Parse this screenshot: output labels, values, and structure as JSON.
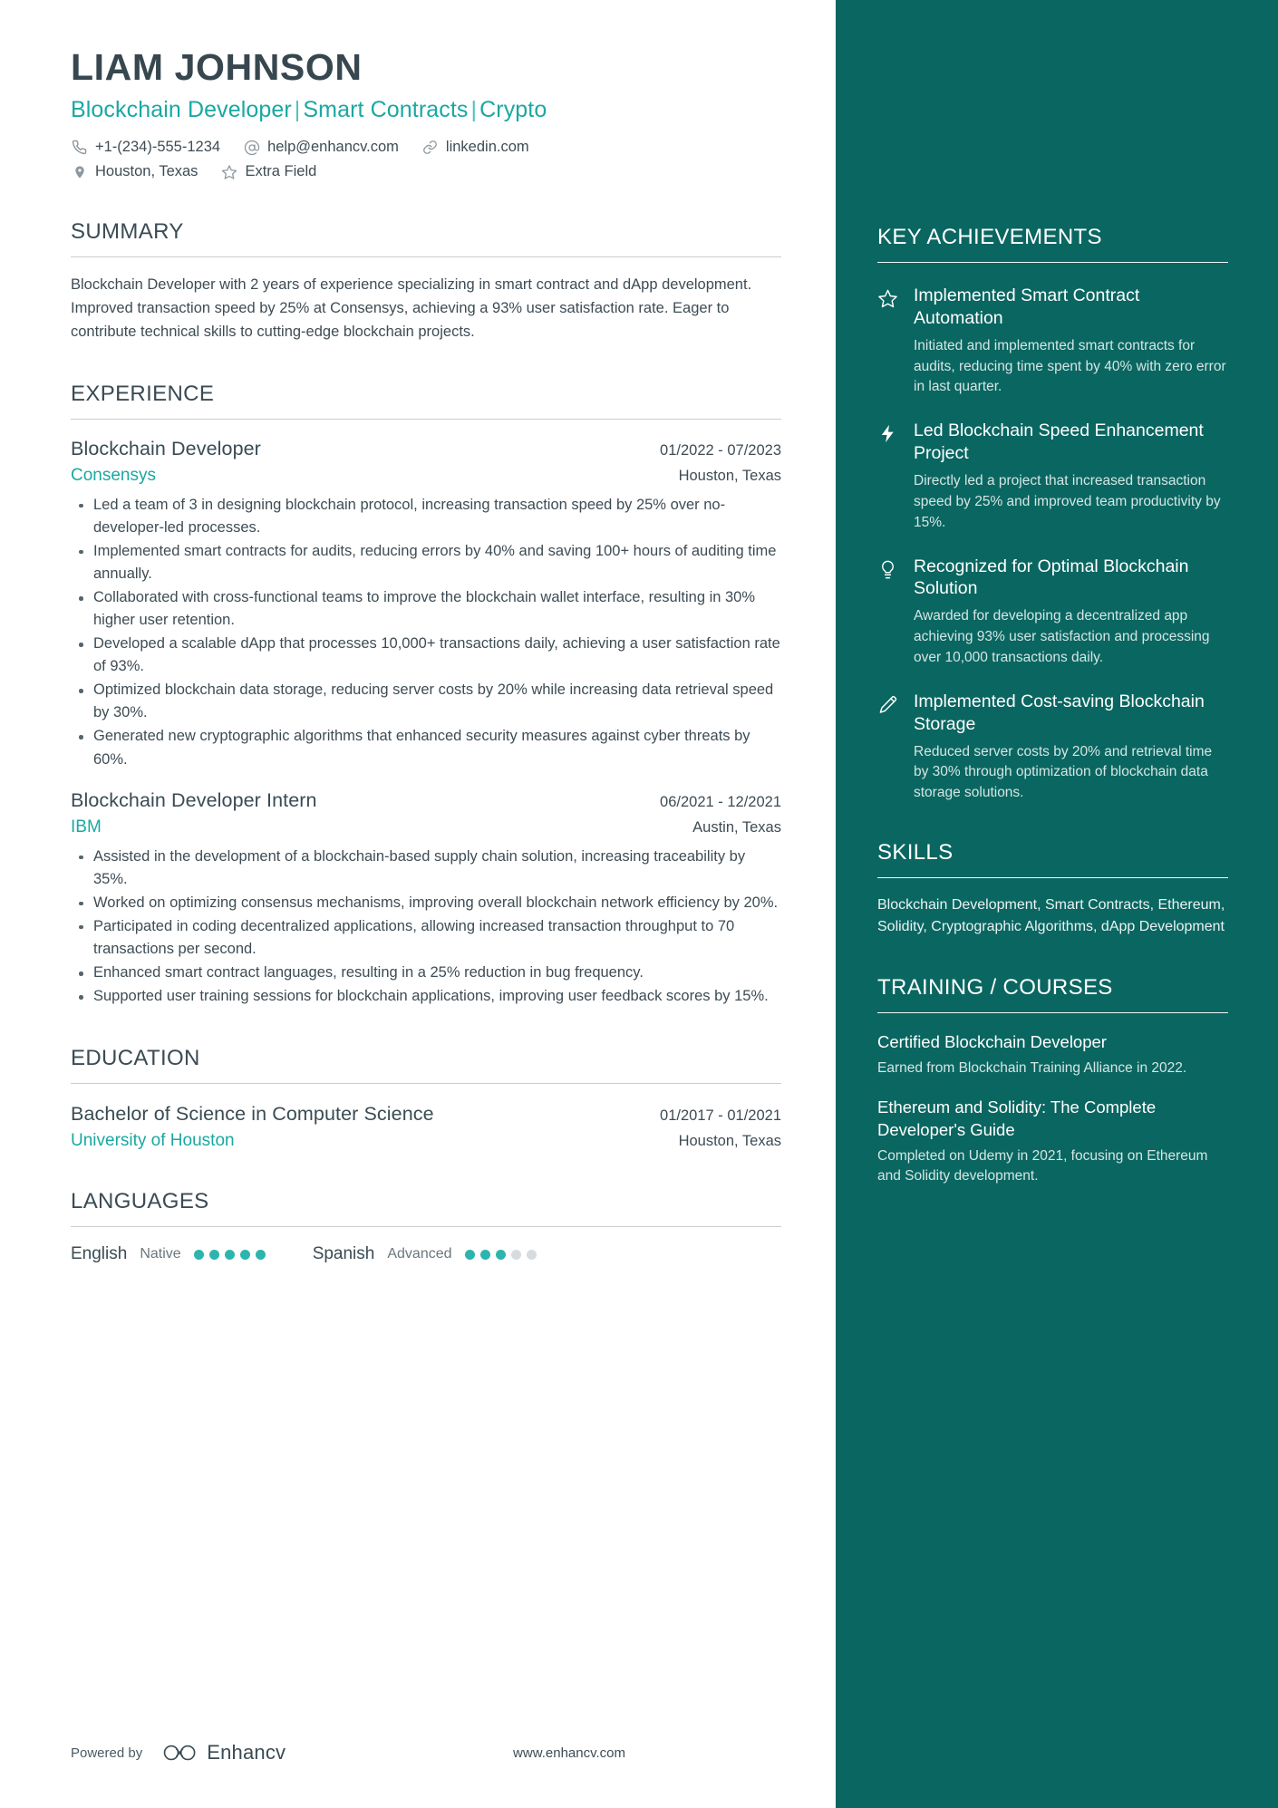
{
  "header": {
    "name": "LIAM JOHNSON",
    "headline_parts": [
      "Blockchain Developer",
      "Smart Contracts",
      "Crypto"
    ],
    "headline_separator": "|",
    "contacts": [
      {
        "icon": "phone-icon",
        "text": "+1-(234)-555-1234"
      },
      {
        "icon": "email-at-icon",
        "text": "help@enhancv.com"
      },
      {
        "icon": "link-icon",
        "text": "linkedin.com"
      },
      {
        "icon": "location-pin-icon",
        "text": "Houston, Texas"
      },
      {
        "icon": "star-outline-icon",
        "text": "Extra Field"
      }
    ]
  },
  "summary": {
    "title": "SUMMARY",
    "text": "Blockchain Developer with 2 years of experience specializing in smart contract and dApp development. Improved transaction speed by 25% at Consensys, achieving a 93% user satisfaction rate. Eager to contribute technical skills to cutting-edge blockchain projects."
  },
  "experience": {
    "title": "EXPERIENCE",
    "jobs": [
      {
        "role": "Blockchain Developer",
        "dates": "01/2022 - 07/2023",
        "company": "Consensys",
        "location": "Houston, Texas",
        "bullets": [
          "Led a team of 3 in designing blockchain protocol, increasing transaction speed by 25% over no-developer-led processes.",
          "Implemented smart contracts for audits, reducing errors by 40% and saving 100+ hours of auditing time annually.",
          "Collaborated with cross-functional teams to improve the blockchain wallet interface, resulting in 30% higher user retention.",
          "Developed a scalable dApp that processes 10,000+ transactions daily, achieving a user satisfaction rate of 93%.",
          "Optimized blockchain data storage, reducing server costs by 20% while increasing data retrieval speed by 30%.",
          "Generated new cryptographic algorithms that enhanced security measures against cyber threats by 60%."
        ]
      },
      {
        "role": "Blockchain Developer Intern",
        "dates": "06/2021 - 12/2021",
        "company": "IBM",
        "location": "Austin, Texas",
        "bullets": [
          "Assisted in the development of a blockchain-based supply chain solution, increasing traceability by 35%.",
          "Worked on optimizing consensus mechanisms, improving overall blockchain network efficiency by 20%.",
          "Participated in coding decentralized applications, allowing increased transaction throughput to 70 transactions per second.",
          "Enhanced smart contract languages, resulting in a 25% reduction in bug frequency.",
          "Supported user training sessions for blockchain applications, improving user feedback scores by 15%."
        ]
      }
    ]
  },
  "education": {
    "title": "EDUCATION",
    "entries": [
      {
        "degree": "Bachelor of Science in Computer Science",
        "dates": "01/2017 - 01/2021",
        "school": "University of Houston",
        "location": "Houston, Texas"
      }
    ]
  },
  "languages": {
    "title": "LANGUAGES",
    "items": [
      {
        "name": "English",
        "level": "Native",
        "filled": 5,
        "total": 5
      },
      {
        "name": "Spanish",
        "level": "Advanced",
        "filled": 3,
        "total": 5
      }
    ]
  },
  "key_achievements": {
    "title": "KEY ACHIEVEMENTS",
    "items": [
      {
        "icon": "star-outline-icon",
        "title": "Implemented Smart Contract Automation",
        "desc": "Initiated and implemented smart contracts for audits, reducing time spent by 40% with zero error in last quarter."
      },
      {
        "icon": "lightning-bolt-icon",
        "title": "Led Blockchain Speed Enhancement Project",
        "desc": "Directly led a project that increased transaction speed by 25% and improved team productivity by 15%."
      },
      {
        "icon": "lightbulb-icon",
        "title": "Recognized for Optimal Blockchain Solution",
        "desc": "Awarded for developing a decentralized app achieving 93% user satisfaction and processing over 10,000 transactions daily."
      },
      {
        "icon": "pen-tool-icon",
        "title": "Implemented Cost-saving Blockchain Storage",
        "desc": "Reduced server costs by 20% and retrieval time by 30% through optimization of blockchain data storage solutions."
      }
    ]
  },
  "skills": {
    "title": "SKILLS",
    "text": "Blockchain Development, Smart Contracts, Ethereum, Solidity, Cryptographic Algorithms, dApp Development"
  },
  "training": {
    "title": "TRAINING / COURSES",
    "items": [
      {
        "title": "Certified Blockchain Developer",
        "desc": "Earned from Blockchain Training Alliance in 2022."
      },
      {
        "title": "Ethereum and Solidity: The Complete Developer's Guide",
        "desc": "Completed on Udemy in 2021, focusing on Ethereum and Solidity development."
      }
    ]
  },
  "footer": {
    "powered_by": "Powered by",
    "brand": "Enhancv",
    "url": "www.enhancv.com"
  },
  "colors": {
    "sidebar_bg": "#0a6661",
    "accent_teal": "#1aa8a2",
    "heading_slate": "#3a4b54",
    "body_text": "#3e4c54"
  }
}
